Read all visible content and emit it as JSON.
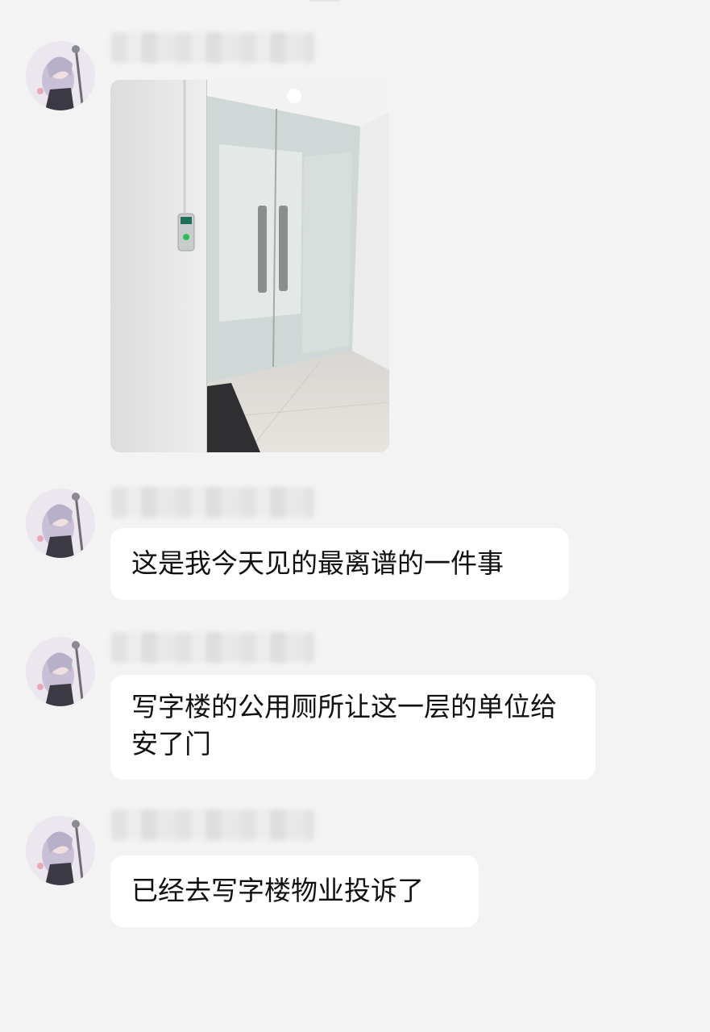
{
  "messages": [
    {
      "type": "image",
      "image_desc": "photo-glass-door"
    },
    {
      "type": "text",
      "text": "这是我今天见的最离谱的一件事"
    },
    {
      "type": "text",
      "text": "写字楼的公用厕所让这一层的单位给安了门"
    },
    {
      "type": "text",
      "text": "已经去写字楼物业投诉了"
    }
  ],
  "colors": {
    "background": "#f3f3f3",
    "bubble": "#ffffff",
    "text": "#111111"
  }
}
